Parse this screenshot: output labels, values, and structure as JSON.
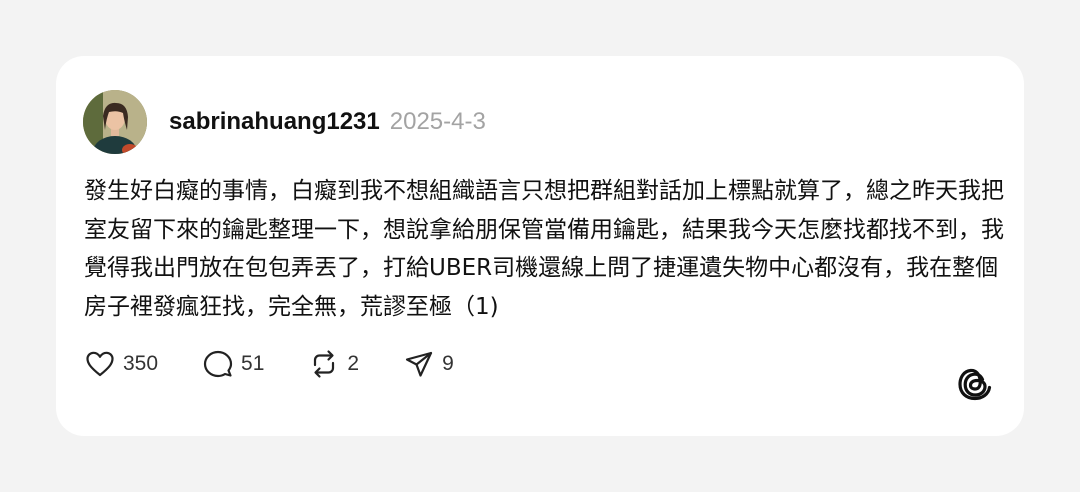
{
  "post": {
    "username": "sabrinahuang1231",
    "date": "2025-4-3",
    "text": "發生好白癡的事情，白癡到我不想組織語言只想把群組對話加上標點就算了，總之昨天我把室友留下來的鑰匙整理一下，想說拿給朋保管當備用鑰匙，結果我今天怎麼找都找不到，我覺得我出門放在包包弄丟了，打給UBER司機還線上問了捷運遺失物中心都沒有，我在整個房子裡發瘋狂找，完全無，荒謬至極（1)"
  },
  "actions": {
    "likes": "350",
    "replies": "51",
    "reposts": "2",
    "shares": "9"
  },
  "icons": {
    "like": "heart-icon",
    "reply": "speech-bubble-icon",
    "repost": "repost-icon",
    "share": "send-icon",
    "brand": "threads-logo-icon"
  },
  "colors": {
    "background": "#f3f3f3",
    "card": "#ffffff",
    "date": "#a3a3a3"
  }
}
